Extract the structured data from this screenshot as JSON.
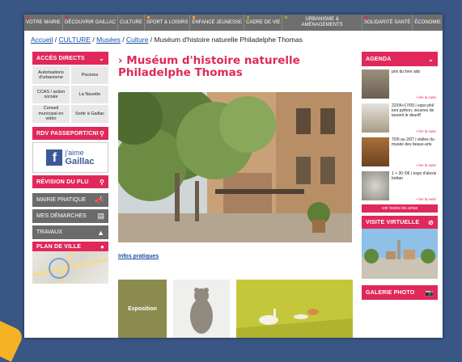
{
  "nav": {
    "items": [
      {
        "label": "VOTRE MAIRIE",
        "color": "#e0285a"
      },
      {
        "label": "DÉCOUVRIR GAILLAC",
        "color": "#e0285a"
      },
      {
        "label": "CULTURE",
        "color": "#8a5c9c"
      },
      {
        "label": "SPORT & LOISIRS",
        "color": "#f5a623"
      },
      {
        "label": "ENFANCE JEUNESSE",
        "color": "#f5a623"
      },
      {
        "label": "CADRE DE VIE",
        "color": "#7ab648"
      },
      {
        "label": "URBANISME & AMÉNAGEMENTS",
        "color": "#7ab648"
      },
      {
        "label": "SOLIDARITÉ SANTÉ",
        "color": "#e0285a"
      },
      {
        "label": "ÉCONOMIE",
        "color": "#3b7fc4"
      }
    ]
  },
  "breadcrumb": {
    "home": "Accueil",
    "sep1": " / ",
    "culture": "CULTURE",
    "sep2": " / ",
    "musees": "Musées",
    "sep3": " / ",
    "culture2": "Culture",
    "sep4": " / ",
    "current": "Muséum d'histoire naturelle Philadelphe Thomas"
  },
  "left": {
    "acces_title": "ACCÈS DIRECTS",
    "acces_items": [
      "Autorisations d'urbanisme",
      "Piscines",
      "CCAS / action sociale",
      "La Navette",
      "Conseil municipal en vidéo",
      "Sortir à Gaillac"
    ],
    "rdv": "RDV PASSEPORT/CNI",
    "fb_line1": "j'aime",
    "fb_line2": "Gaillac",
    "revision": "RÉVISION DU PLU",
    "mairie": "MAIRIE PRATIQUE",
    "demarches": "MES DÉMARCHES",
    "travaux": "TRAVAUX",
    "plan": "PLAN DE VILLE"
  },
  "main": {
    "title": "› Muséum d'histoire naturelle Philadelphe Thomas",
    "infos": "Infos pratiques",
    "thumb1": "Exposition"
  },
  "right": {
    "agenda": "AGENDA",
    "items": [
      {
        "text": "prix du livre ado",
        "more": "• lire la suite"
      },
      {
        "text": "22/04>17/09 | expo phil tom python, oeuvres de laurent le deunff",
        "more": "• lire la suite"
      },
      {
        "text": "7/05 au 2/07 | visites du musée des beaux-arts",
        "more": "• lire la suite"
      },
      {
        "text": "1 > 30 /06 | expo d'alexis bottan",
        "more": "• lire la suite"
      }
    ],
    "voir_tout": "voir toutes les actus",
    "visite": "VISITE VIRTUELLE",
    "galerie": "GALERIE PHOTO"
  },
  "colors": {
    "accent": "#e0285a",
    "nav_bg": "#6e6e6e",
    "link": "#1a4fa8"
  }
}
